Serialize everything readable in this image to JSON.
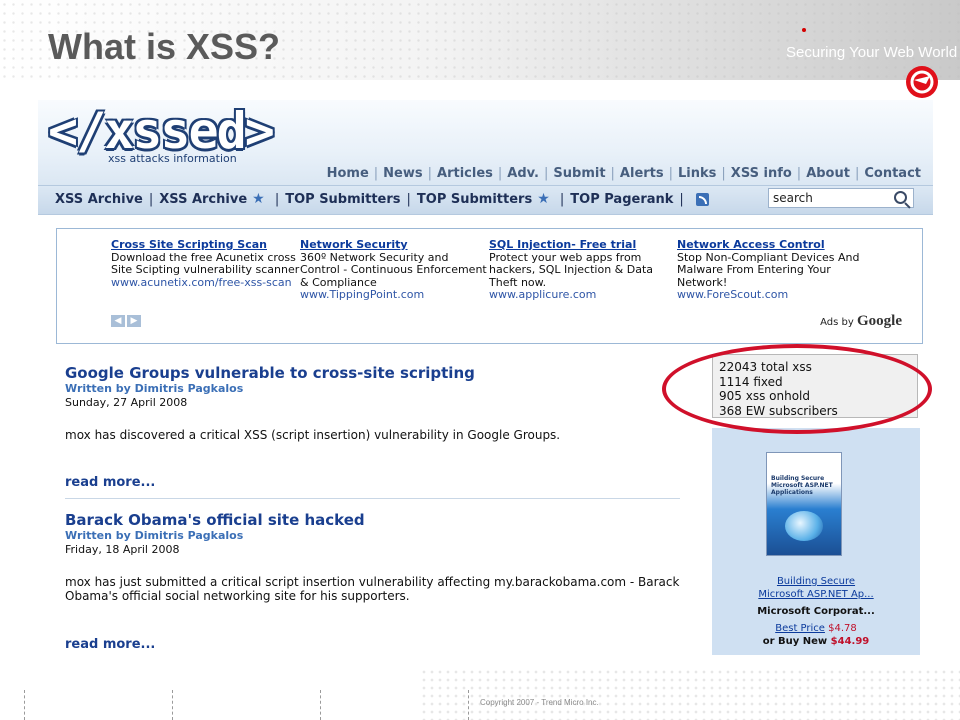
{
  "slide": {
    "title": "What is XSS?",
    "tagline": "Securing Your Web World",
    "copyright": "Copyright 2007 - Trend Micro Inc."
  },
  "site": {
    "logo_text": "</xssed>",
    "logo_subtitle": "xss attacks information",
    "top_nav": [
      "Home",
      "News",
      "Articles",
      "Adv.",
      "Submit",
      "Alerts",
      "Links",
      "XSS info",
      "About",
      "Contact"
    ],
    "sub_nav": {
      "items": [
        "XSS Archive",
        "XSS Archive",
        "TOP Submitters",
        "TOP Submitters",
        "TOP Pagerank"
      ]
    },
    "search_value": "search"
  },
  "ads": [
    {
      "title": "Cross Site Scripting Scan",
      "text": "Download the free Acunetix cross Site Scipting vulnerability scanner",
      "url": "www.acunetix.com/free-xss-scan"
    },
    {
      "title": "Network Security",
      "text": "360º Network Security and Control - Continuous Enforcement & Compliance",
      "url": "www.TippingPoint.com"
    },
    {
      "title": "SQL Injection- Free trial",
      "text": "Protect your web apps from hackers, SQL Injection & Data Theft now.",
      "url": "www.applicure.com"
    },
    {
      "title": "Network Access Control",
      "text": "Stop Non-Compliant Devices And Malware From Entering Your Network!",
      "url": "www.ForeScout.com"
    }
  ],
  "ads_by": "Ads by",
  "ads_brand": "Google",
  "articles": [
    {
      "title": "Google Groups vulnerable to cross-site scripting",
      "author": "Written by Dimitris Pagkalos",
      "date": "Sunday, 27 April 2008",
      "body": "mox has discovered a critical XSS (script insertion) vulnerability in Google Groups.",
      "read_more": "read more..."
    },
    {
      "title": "Barack Obama's official site hacked",
      "author": "Written by Dimitris Pagkalos",
      "date": "Friday, 18 April 2008",
      "body": "mox has just submitted a critical script insertion vulnerability affecting my.barackobama.com - Barack Obama's official social networking site for his supporters.",
      "read_more": "read more..."
    }
  ],
  "stats": [
    "22043 total xss",
    "1114 fixed",
    "905 xss onhold",
    "368 EW subscribers"
  ],
  "book": {
    "cover_title": "Building Secure Microsoft ASP.NET Applications",
    "link_line1": "Building Secure",
    "link_line2": "Microsoft ASP.NET Ap...",
    "publisher": "Microsoft Corporat...",
    "best_price_label": "Best Price",
    "best_price": "$4.78",
    "buy_new_label": "or Buy New",
    "buy_new_price": "$44.99"
  },
  "colors": {
    "highlight_ring": "#d0102a",
    "link_blue": "#1a3f8f"
  }
}
